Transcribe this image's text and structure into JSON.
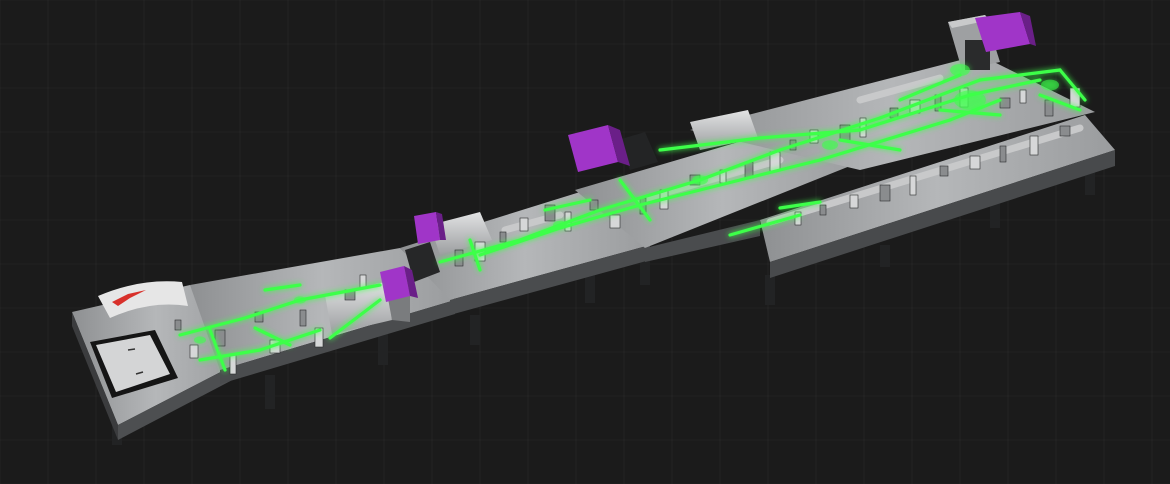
{
  "scene": {
    "colors": {
      "background": "#1b1b1b",
      "grid": "#2a2a2a",
      "grid_dot": "#353535",
      "table_top": "#a9abad",
      "table_side": "#4a4c4e",
      "table_leg": "#232425",
      "beam": "#3dff4a",
      "enclosure": "#a035c8",
      "enclosure_dark": "#6a1f88",
      "housing": "#cfd1d3",
      "housing_dark": "#3a3b3d",
      "accent_red": "#d8302a"
    },
    "labels": []
  }
}
